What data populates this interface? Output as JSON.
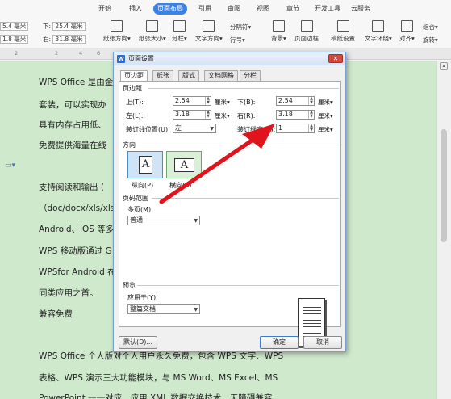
{
  "ribbon": {
    "tabs": [
      "开始",
      "插入",
      "页面布局",
      "引用",
      "审阅",
      "视图",
      "章节",
      "开发工具",
      "云服务"
    ],
    "active_tab": "页面布局",
    "margin_fields": [
      {
        "prefix": "",
        "value": "5.4 毫米"
      },
      {
        "prefix": "下:",
        "value": "25.4 毫米"
      },
      {
        "prefix": "",
        "value": "1.8 毫米"
      },
      {
        "prefix": "右:",
        "value": "31.8 毫米"
      }
    ],
    "buttons": [
      {
        "label": "纸张方向▾",
        "icon": "page-orientation-icon"
      },
      {
        "label": "纸张大小▾",
        "icon": "page-size-icon"
      },
      {
        "label": "分栏▾",
        "icon": "columns-icon"
      },
      {
        "label": "文字方向▾",
        "icon": "text-direction-icon"
      },
      {
        "label": "背景▾",
        "icon": "background-icon"
      },
      {
        "label": "页面边框",
        "icon": "page-border-icon"
      },
      {
        "label": "稿纸设置",
        "icon": "manuscript-icon"
      },
      {
        "label": "文字环绕▾",
        "icon": "text-wrap-icon"
      },
      {
        "label": "对齐▾",
        "icon": "align-icon"
      }
    ],
    "small_buttons": [
      "分隔符▾",
      "行号▾",
      "组合▾",
      "旋转▾"
    ]
  },
  "ruler": {
    "marks": [
      "2",
      "2",
      "4",
      "6"
    ]
  },
  "document": {
    "lines": [
      "WPS Office 是由金",
      "套装，可以实现办",
      "具有内存占用低、",
      "免费提供海量在线",
      "支持阅读和输出 (",
      "（doc/docx/xls/xlsx",
      "Android、iOS 等多",
      "WPS 移动版通过 G",
      "WPSfor Android 在",
      "同类应用之首。",
      "兼容免费",
      "WPS Office 个人版对个人用户永久免费，包含 WPS 文字、WPS",
      "表格、WPS 演示三大功能模块，与 MS Word、MS Excel、MS",
      "PowerPoint 一一对应，应用 XML 数据交换技术，无障碍兼容"
    ]
  },
  "dialog": {
    "title": "页面设置",
    "tabs": [
      "页边距",
      "纸张",
      "版式",
      "文档网格",
      "分栏"
    ],
    "active_tab": "页边距",
    "margins": {
      "section": "页边距",
      "top_label": "上(T):",
      "top_value": "2.54",
      "bottom_label": "下(B):",
      "bottom_value": "2.54",
      "left_label": "左(L):",
      "left_value": "3.18",
      "right_label": "右(R):",
      "right_value": "3.18",
      "gutter_pos_label": "装订线位置(U):",
      "gutter_pos_value": "左",
      "gutter_width_label": "装订线宽(G):",
      "gutter_width_value": "1",
      "unit": "厘米▾"
    },
    "orientation": {
      "section": "方向",
      "portrait_label": "纵向(P)",
      "landscape_label": "横向(S)",
      "portrait_glyph": "A",
      "landscape_glyph": "A",
      "selected": "纵向(P)"
    },
    "page_range": {
      "section": "页码范围",
      "multi_label": "多页(M):",
      "multi_value": "普通"
    },
    "preview": {
      "section": "预览",
      "apply_label": "应用于(Y):",
      "apply_value": "整篇文档"
    },
    "buttons": {
      "default": "默认(D)...",
      "ok": "确定",
      "cancel": "取消"
    },
    "close_glyph": "✕",
    "logo": "W"
  },
  "colors": {
    "accent": "#3b82e8",
    "doc_background": "#cfe9cd",
    "arrow": "#e0141c"
  }
}
